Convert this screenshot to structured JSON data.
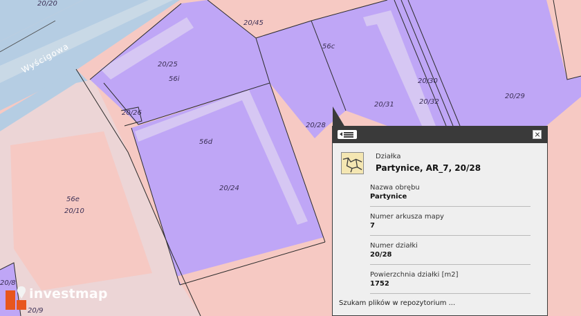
{
  "map": {
    "colors": {
      "background": "#f6c9c3",
      "parcel_fill": "#bfa6f6",
      "road_fill": "#b5cde3",
      "sidewalk_fill": "#e7cfd0",
      "building_outline": "#d6c7f3",
      "parcel_line": "#2b2b2b"
    },
    "street_name": "Wyścigowa",
    "parcel_labels": [
      "20/20",
      "20/45",
      "56c",
      "20/25",
      "56i",
      "20/26",
      "20/30",
      "20/31",
      "20/32",
      "20/29",
      "20/28",
      "56d",
      "20/24",
      "56e",
      "20/10",
      "20/8",
      "20/9"
    ]
  },
  "popup": {
    "type_label": "Działka",
    "title": "Partynice, AR_7, 20/28",
    "fields": [
      {
        "label": "Nazwa obrębu",
        "value": "Partynice"
      },
      {
        "label": "Numer arkusza mapy",
        "value": "7"
      },
      {
        "label": "Numer działki",
        "value": "20/28"
      },
      {
        "label": "Powierzchnia działki [m2]",
        "value": "1752"
      }
    ],
    "status_text": "Szukam plików w repozytorium ..."
  },
  "watermark": {
    "brand": "investmap",
    "logo_colors": [
      "#e8561d",
      "#f08a2c"
    ]
  }
}
